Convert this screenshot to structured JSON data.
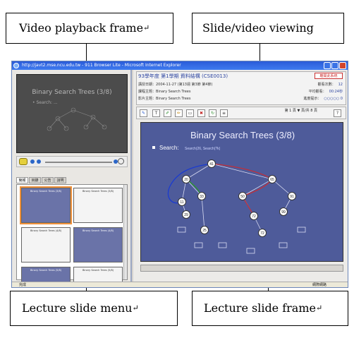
{
  "callouts": {
    "playback": "Video playback frame",
    "viewing": "Slide/video viewing",
    "menu": "Lecture slide menu",
    "frame": "Lecture slide frame",
    "arrow_mark": "↵"
  },
  "window": {
    "title": "http://javt2.mse.ncu.edu.tw - 911 Browser Lite - Microsoft Internet Explorer"
  },
  "video": {
    "slide_title": "Binary Search Trees (3/8)",
    "bullet": "• Search: ..."
  },
  "slide_tabs": [
    "簡報",
    "目錄",
    "公告",
    "說明"
  ],
  "thumbnails": [
    {
      "label": "Binary Search Trees (3/8)"
    },
    {
      "label": "Binary Search Trees (3/8)"
    },
    {
      "label": "Binary Search Trees (4/8)"
    },
    {
      "label": "Binary Search Trees (4/8)"
    },
    {
      "label": "Binary Search Trees (5/8)"
    },
    {
      "label": "Binary Search Trees (5/8)"
    }
  ],
  "course": {
    "title": "93學年度 第1學期 資料結構 (CSE0013)",
    "logout": "離開此系統",
    "date_row": "講授日期：2004-11-27 (第13週 第3節 第4節)",
    "topic_row": "課程主題：Binary Search Trees",
    "slide_row": "影片主題：Binary Search Trees",
    "stats": [
      {
        "label": "觀看次數：",
        "value": "12"
      },
      {
        "label": "平均觀看：",
        "value": "00:24秒"
      },
      {
        "label": "進度提示：",
        "value": "○○○○○ 0"
      }
    ]
  },
  "toolbar": {
    "page_label": "第 1 頁 ▼ 頁/共 8 頁"
  },
  "slide": {
    "title": "Binary Search Trees (3/8)",
    "bullet": "Search:",
    "bullet_detail": "Search(26, Search(?k)",
    "nodes": [
      "41",
      "20",
      "65",
      "11",
      "33",
      "50",
      "91",
      "29",
      "72",
      "99",
      "25",
      "72"
    ]
  },
  "statusbar": {
    "left": "完成",
    "zone": "網際網路"
  },
  "colors": {
    "slide_bg": "#4e5b9a",
    "titlebar": "#2a5bd8",
    "selected_thumb": "#f0913a",
    "course_text": "#2d45a0"
  }
}
